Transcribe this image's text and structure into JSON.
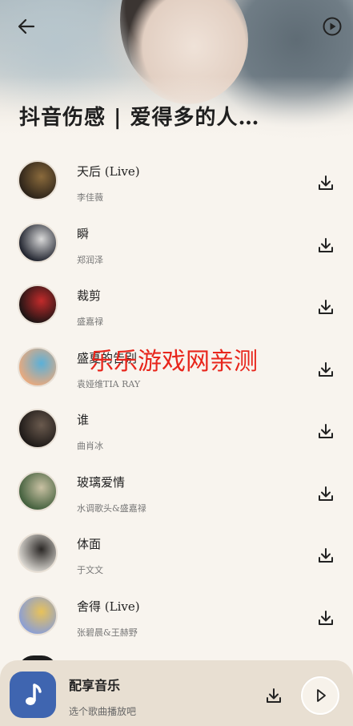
{
  "header": {
    "title": "抖音伤感 | 爱得多的人…",
    "back_icon": "back-arrow-icon",
    "play_all_icon": "play-circle-icon"
  },
  "songs": [
    {
      "title": "天后 (Live)",
      "artist": "李佳薇",
      "cover_colors": [
        "#2a2118",
        "#8a6a3c"
      ]
    },
    {
      "title": "瞬",
      "artist": "郑润泽",
      "cover_colors": [
        "#1c1f2a",
        "#d9d9d9"
      ]
    },
    {
      "title": "裁剪",
      "artist": "盛嘉禄",
      "cover_colors": [
        "#1a1414",
        "#c22b2b"
      ]
    },
    {
      "title": "盛夏的告别",
      "artist": "袁娅维TIA RAY",
      "cover_colors": [
        "#e9a97d",
        "#5bb0d8"
      ]
    },
    {
      "title": "谁",
      "artist": "曲肖冰",
      "cover_colors": [
        "#1c1816",
        "#6a5a4e"
      ]
    },
    {
      "title": "玻璃爱情",
      "artist": "水调歌头&盛嘉禄",
      "cover_colors": [
        "#3f5d3a",
        "#c9c1a3"
      ]
    },
    {
      "title": "体面",
      "artist": "于文文",
      "cover_colors": [
        "#d9d6d0",
        "#2b2826"
      ]
    },
    {
      "title": "舍得 (Live)",
      "artist": "张碧晨&王赫野",
      "cover_colors": [
        "#8a9ed6",
        "#e8c25a"
      ]
    }
  ],
  "watermark": "乐乐游戏网亲测",
  "player": {
    "title": "配享音乐",
    "subtitle": "选个歌曲播放吧",
    "accent": "#3f65b0",
    "art_icon": "music-note-icon",
    "download_icon": "download-icon",
    "play_icon": "play-icon"
  }
}
